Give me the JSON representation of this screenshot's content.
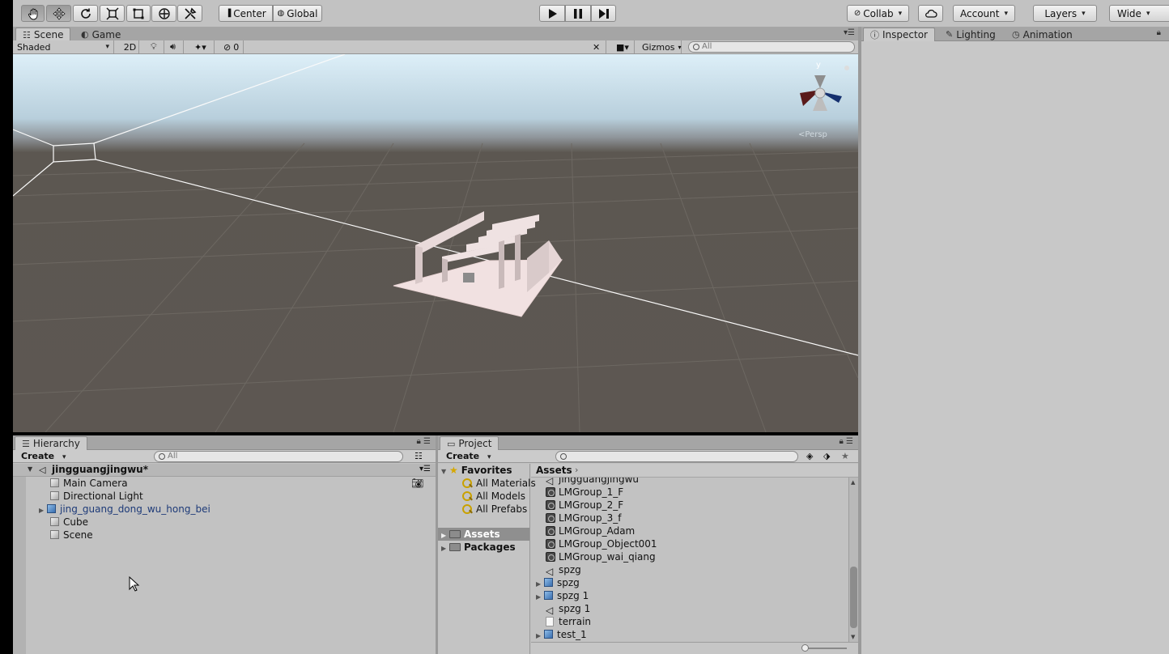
{
  "toolbar": {
    "pivot_label": "Center",
    "space_label": "Global",
    "collab_label": "Collab",
    "account_label": "Account",
    "layers_label": "Layers",
    "layout_label": "Wide"
  },
  "scene_tabs": {
    "scene": "Scene",
    "game": "Game"
  },
  "scene_toolbar": {
    "draw_mode": "Shaded",
    "mode_2d": "2D",
    "hidden_count": "0",
    "gizmos_label": "Gizmos",
    "search_placeholder": "All"
  },
  "viewport": {
    "persp_label": "<Persp",
    "axis_y": "y"
  },
  "inspector_tabs": {
    "inspector": "Inspector",
    "lighting": "Lighting",
    "animation": "Animation"
  },
  "hierarchy": {
    "tab": "Hierarchy",
    "create_label": "Create",
    "search_placeholder": "All",
    "scene_name": "jingguangjingwu*",
    "items": [
      {
        "label": "Main Camera"
      },
      {
        "label": "Directional Light"
      },
      {
        "label": "jing_guang_dong_wu_hong_bei"
      },
      {
        "label": "Cube"
      },
      {
        "label": "Scene"
      }
    ]
  },
  "project": {
    "tab": "Project",
    "create_label": "Create",
    "search_placeholder": "",
    "favorites_label": "Favorites",
    "favorites": [
      "All Materials",
      "All Models",
      "All Prefabs"
    ],
    "assets_label": "Assets",
    "packages_label": "Packages",
    "breadcrumb": "Assets",
    "files": [
      "jingguangjingwu",
      "LMGroup_1_F",
      "LMGroup_2_F",
      "LMGroup_3_f",
      "LMGroup_Adam",
      "LMGroup_Object001",
      "LMGroup_wai_qiang",
      "spzg",
      "spzg",
      "spzg 1",
      "spzg 1",
      "terrain",
      "test_1"
    ]
  },
  "colors": {
    "toolbar_bg": "#c2c2c2",
    "panel_bg": "#c2c2c2",
    "tab_bar": "#a5a5a5",
    "prefab_text": "#1d3a78",
    "ground": "#5d5752"
  }
}
